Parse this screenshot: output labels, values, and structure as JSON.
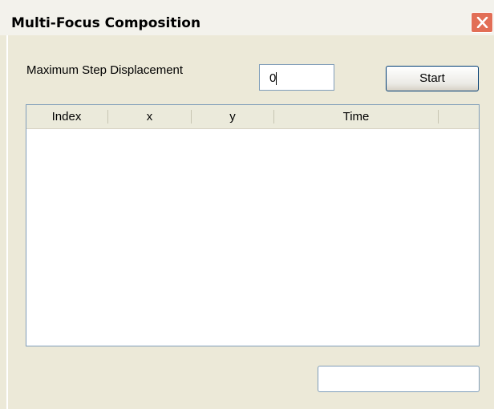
{
  "window": {
    "title": "Multi-Focus Composition",
    "close_icon": "close-x-icon"
  },
  "form": {
    "step_label": "Maximum Step Displacement",
    "step_value": "0",
    "start_label": "Start"
  },
  "table": {
    "columns": [
      "Index",
      "x",
      "y",
      "Time"
    ],
    "rows": []
  },
  "status": {
    "value": ""
  },
  "colors": {
    "close_button": "#e26e56",
    "dialog_background": "#ece9d8",
    "input_border": "#7f9db9"
  }
}
